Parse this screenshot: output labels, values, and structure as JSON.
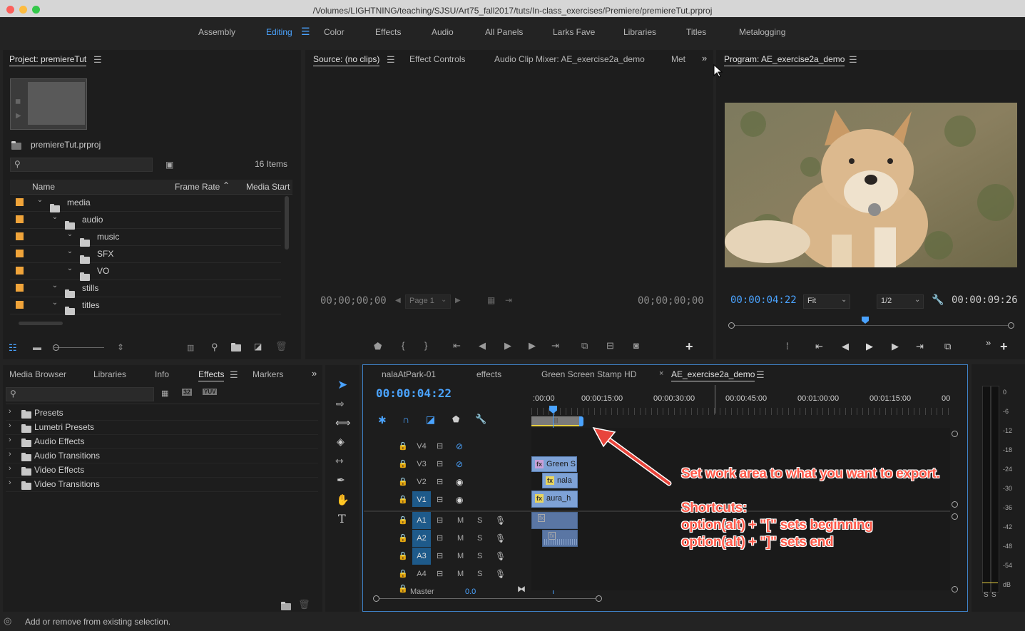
{
  "app": {
    "path": "/Volumes/LIGHTNING/teaching/SJSU/Art75_fall2017/tuts/In-class_exercises/Premiere/premiereTut.prproj"
  },
  "workspaces": [
    "Assembly",
    "Editing",
    "Color",
    "Effects",
    "Audio",
    "All Panels",
    "Larks Fave",
    "Libraries",
    "Titles",
    "Metalogging"
  ],
  "project": {
    "tab": "Project: premiereTut",
    "file": "premiereTut.prproj",
    "count": "16 Items",
    "col_name": "Name",
    "col_rate": "Frame Rate",
    "col_start": "Media Start",
    "rows": [
      {
        "label": "media",
        "indent": 0
      },
      {
        "label": "audio",
        "indent": 1
      },
      {
        "label": "music",
        "indent": 2
      },
      {
        "label": "SFX",
        "indent": 2
      },
      {
        "label": "VO",
        "indent": 2
      },
      {
        "label": "stills",
        "indent": 1
      },
      {
        "label": "titles",
        "indent": 1
      }
    ]
  },
  "source": {
    "tabs": [
      "Source: (no clips)",
      "Effect Controls",
      "Audio Clip Mixer: AE_exercise2a_demo",
      "Met"
    ],
    "tc_left": "00;00;00;00",
    "tc_right": "00;00;00;00",
    "page": "Page 1"
  },
  "program": {
    "tab": "Program: AE_exercise2a_demo",
    "tc": "00:00:04:22",
    "fit": "Fit",
    "res": "1/2",
    "duration": "00:00:09:26",
    "playhead_fraction": 0.48
  },
  "effects_panel": {
    "tabs": [
      "Media Browser",
      "Libraries",
      "Info",
      "Effects",
      "Markers"
    ],
    "items": [
      "Presets",
      "Lumetri Presets",
      "Audio Effects",
      "Audio Transitions",
      "Video Effects",
      "Video Transitions"
    ],
    "btn_32": "32",
    "btn_yuv": "YUV"
  },
  "timeline": {
    "tabs": [
      "nalaAtPark-01",
      "effects",
      "Green Screen Stamp HD",
      "AE_exercise2a_demo"
    ],
    "tc": "00:00:04:22",
    "ruler": [
      ":00:00",
      "00:00:15:00",
      "00:00:30:00",
      "00:00:45:00",
      "00:01:00:00",
      "00:01:15:00",
      "00"
    ],
    "video_tracks": [
      "V4",
      "V3",
      "V2",
      "V1"
    ],
    "audio_tracks": [
      "A1",
      "A2",
      "A3",
      "A4"
    ],
    "master": "Master",
    "master_val": "0.0",
    "m": "M",
    "s": "S",
    "clips": {
      "v3": "Green S",
      "v2": "nala",
      "v1": "aura_h"
    }
  },
  "meter": {
    "labels": [
      "0",
      "-6",
      "-12",
      "-18",
      "-24",
      "-30",
      "-36",
      "-42",
      "-48",
      "-54",
      "dB"
    ],
    "solo": "S"
  },
  "annotation": {
    "main": "Set work area to what you want to export.",
    "shortcuts": "Shortcuts:",
    "line1": "option(alt) + \"[\" sets beginning",
    "line2": "option(alt) + \"]\" sets end"
  },
  "status": "Add or remove from existing selection."
}
